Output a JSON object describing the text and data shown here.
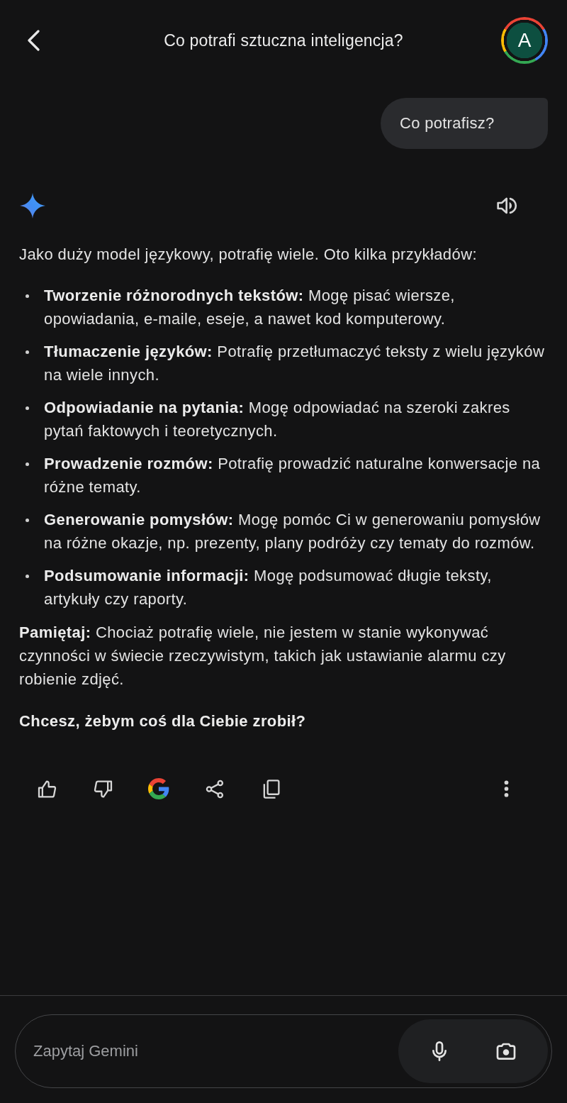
{
  "header": {
    "title": "Co potrafi sztuczna inteligencja?",
    "avatar_initial": "A"
  },
  "user_message": {
    "text": "Co potrafisz?"
  },
  "response": {
    "intro": "Jako duży model językowy, potrafię wiele. Oto kilka przykładów:",
    "items": [
      "**Tworzenie różnorodnych tekstów:** Mogę pisać wiersze, opowiadania, e-maile, eseje, a nawet kod komputerowy.",
      "**Tłumaczenie języków:** Potrafię przetłumaczyć teksty z wielu języków na wiele innych.",
      "**Odpowiadanie na pytania:** Mogę odpowiadać na szeroki zakres pytań faktowych i teoretycznych.",
      "**Prowadzenie rozmów:** Potrafię prowadzić naturalne konwersacje na różne tematy.",
      "**Generowanie pomysłów:** Mogę pomóc Ci w generowaniu pomysłów na różne okazje, np. prezenty, plany podróży czy tematy do rozmów.",
      "**Podsumowanie informacji:** Mogę podsumować długie teksty, artykuły czy raporty."
    ],
    "note": "**Pamiętaj:** Chociaż potrafię wiele, nie jestem w stanie wykonywać czynności w świecie rzeczywistym, takich jak ustawianie alarmu czy robienie zdjęć.",
    "closing": "Chcesz, żebym coś dla Ciebie zrobił?"
  },
  "input": {
    "placeholder": "Zapytaj Gemini"
  }
}
